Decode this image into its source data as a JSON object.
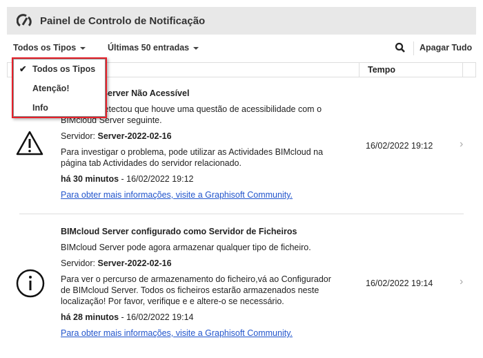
{
  "header": {
    "title": "Painel de Controlo de Notificação",
    "icon": "gauge-icon"
  },
  "toolbar": {
    "type_filter": "Todos os Tipos",
    "entries_filter": "Últimas 50 entradas",
    "search_icon": "search-icon",
    "clear_all": "Apagar Tudo"
  },
  "table": {
    "col_time": "Tempo"
  },
  "menu": {
    "items": [
      {
        "label": "Todos os Tipos",
        "checked": true
      },
      {
        "label": "Atenção!"
      },
      {
        "label": "Info"
      }
    ]
  },
  "rows": [
    {
      "icon": "warning-icon",
      "title": "BIMcloud Server Não Acessível",
      "desc": "BIMcloud detectou que houve uma questão de acessibilidade com o BIMcloud Server seguinte.",
      "server_label": "Servidor:",
      "server": "Server-2022-02-16",
      "detail": "Para investigar o problema, pode utilizar as Actividades BIMcloud na página tab Actividades do servidor relacionado.",
      "ago": "há 30 minutos",
      "date": " - 16/02/2022 19:12",
      "link": "Para obter mais informações, visite a Graphisoft Community.",
      "time": "16/02/2022 19:12"
    },
    {
      "icon": "info-icon",
      "title": "BIMcloud Server configurado como Servidor de Ficheiros",
      "desc": "BIMcloud Server pode agora armazenar qualquer tipo de ficheiro.",
      "server_label": "Servidor:",
      "server": "Server-2022-02-16",
      "detail": "Para ver o percurso de armazenamento do ficheiro,vá ao Configurador de BIMcloud Server. Todos os ficheiros estarão armazenados neste localização! Por favor, verifique e e altere-o se necessário.",
      "ago": "há 28 minutos",
      "date": " - 16/02/2022 19:14",
      "link": "Para obter mais informações, visite a Graphisoft Community.",
      "time": "16/02/2022 19:14"
    }
  ]
}
